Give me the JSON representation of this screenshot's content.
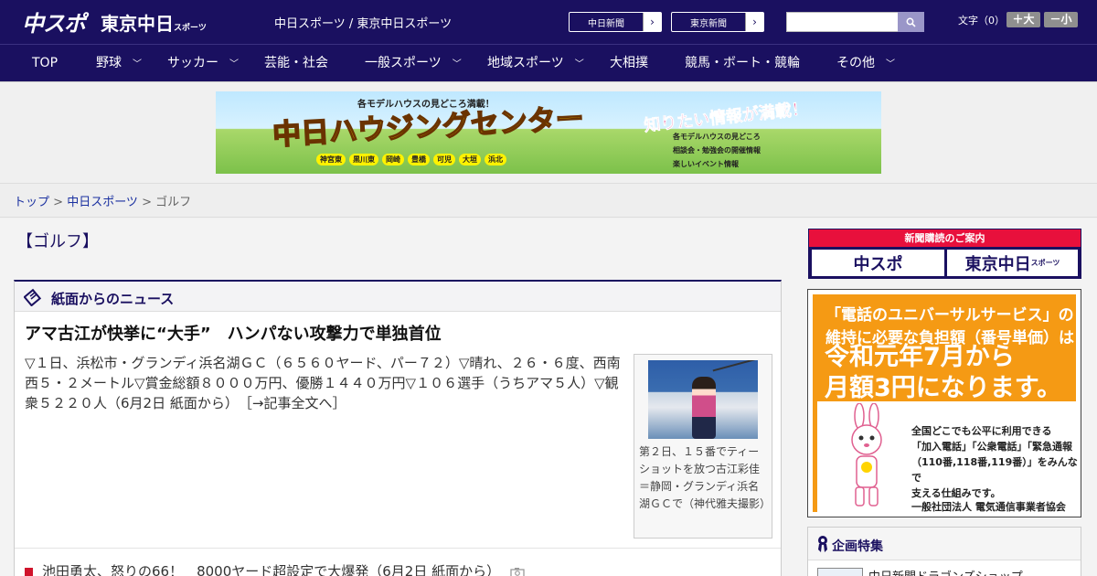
{
  "header": {
    "logo_chuspo": "中スポ",
    "logo_tokyo": "東京中日",
    "logo_tokyo_sub": "スポーツ",
    "site_links": "中日スポーツ / 東京中日スポーツ",
    "btn_chunichi": "中日新聞",
    "btn_tokyo": "東京新聞",
    "btn_arrow": "›",
    "search_value": "",
    "font_label": "文字（0）",
    "font_larger": "＋大",
    "font_smaller": "－小"
  },
  "nav": {
    "items": [
      {
        "label": "TOP",
        "chevron": ""
      },
      {
        "label": "野球",
        "chevron": "﹀"
      },
      {
        "label": "サッカー",
        "chevron": "﹀"
      },
      {
        "label": "芸能・社会",
        "chevron": ""
      },
      {
        "label": "一般スポーツ",
        "chevron": "﹀"
      },
      {
        "label": "地域スポーツ",
        "chevron": "﹀"
      },
      {
        "label": "大相撲",
        "chevron": ""
      },
      {
        "label": "競馬・ボート・競輪",
        "chevron": ""
      },
      {
        "label": "その他",
        "chevron": "﹀"
      }
    ]
  },
  "banner": {
    "top_text": "各モデルハウスの見どころ満載！",
    "main_text": "中日ハウジングセンター",
    "towns": [
      "神宮東",
      "黒川東",
      "岡崎",
      "豊橋",
      "可児",
      "大垣",
      "浜北"
    ],
    "right_text": "知りたい情報が満載！",
    "list": [
      "各モデルハウスの見どころ",
      "相談会・勉強会の開催情報",
      "楽しいイベント情報"
    ]
  },
  "breadcrumb": {
    "top": "トップ",
    "sep": " > ",
    "section": "中日スポーツ",
    "current": "ゴルフ"
  },
  "page_title": "【ゴルフ】",
  "news_section": {
    "heading": "紙面からのニュース",
    "article_title": "アマ古江が快挙に“大手”　ハンパない攻撃力で単独首位",
    "article_body": "▽１日、浜松市・グランディ浜名湖ＧＣ（６５６０ヤード、パー７２）▽晴れ、２６・６度、西南西５・２メートル▽賞金総額８０００万円、優勝１４４０万円▽１０６選手（うちアマ５人）▽観衆５２２０人（6月2日 紙面から）",
    "article_more": "［→記事全文へ］",
    "photo_caption": "第２日、１５番でティーショットを放つ古江彩佳＝静岡・グランディ浜名湖ＧＣで（神代雅夫撮影）",
    "items": [
      {
        "text": "池田勇太、怒りの66！　8000ヤード超設定で大爆発（6月2日 紙面から）"
      }
    ]
  },
  "sidebar": {
    "subscribe_heading": "新聞購読のご案内",
    "subscribe_chuspo": "中スポ",
    "subscribe_tokyo": "東京中日",
    "subscribe_tokyo_sub": "スポーツ",
    "universal_line1": "「電話のユニバーサルサービス」の",
    "universal_line2": "維持に必要な負担額（番号単価）は",
    "universal_big1": "令和元年7月から",
    "universal_big2": "月額3円になります。",
    "universal_small1": "全国どこでも公平に利用できる",
    "universal_small2": "「加入電話」「公衆電話」「緊急通報",
    "universal_small3": "（110番,118番,119番）」をみんなで",
    "universal_small4": "支える仕組みです。",
    "universal_org": "一般社団法人 電気通信事業者協会",
    "feature_heading": "企画特集",
    "feature_item": "中日新聞ドラゴンズショップ"
  },
  "colors": {
    "brand_navy": "#1a1060",
    "accent_red": "#d0142c",
    "banner_orange": "#f59a14"
  }
}
